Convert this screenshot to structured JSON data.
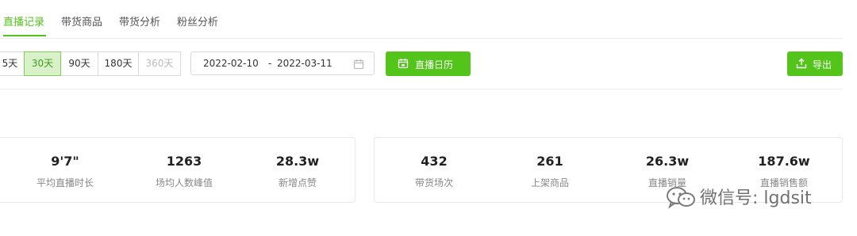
{
  "tabs": [
    "直播记录",
    "带货商品",
    "带货分析",
    "粉丝分析"
  ],
  "active_tab": 0,
  "range_options": [
    "5天",
    "30天",
    "90天",
    "180天",
    "360天"
  ],
  "range_active": "30天",
  "range_disabled": "360天",
  "date_range": {
    "start": "2022-02-10",
    "separator": "-",
    "end": "2022-03-11"
  },
  "buttons": {
    "calendar": "直播日历",
    "export": "导出"
  },
  "stats_left": [
    {
      "value": "9'7\"",
      "label": "平均直播时长"
    },
    {
      "value": "1263",
      "label": "场均人数峰值"
    },
    {
      "value": "28.3w",
      "label": "新增点赞"
    }
  ],
  "stats_right": [
    {
      "value": "432",
      "label": "带货场次"
    },
    {
      "value": "261",
      "label": "上架商品"
    },
    {
      "value": "26.3w",
      "label": "直播销量"
    },
    {
      "value": "187.6w",
      "label": "直播销售额"
    }
  ],
  "watermark": "微信号: lgdsit",
  "colors": {
    "accent": "#52c41a",
    "active_bg": "#d8f1c8"
  }
}
